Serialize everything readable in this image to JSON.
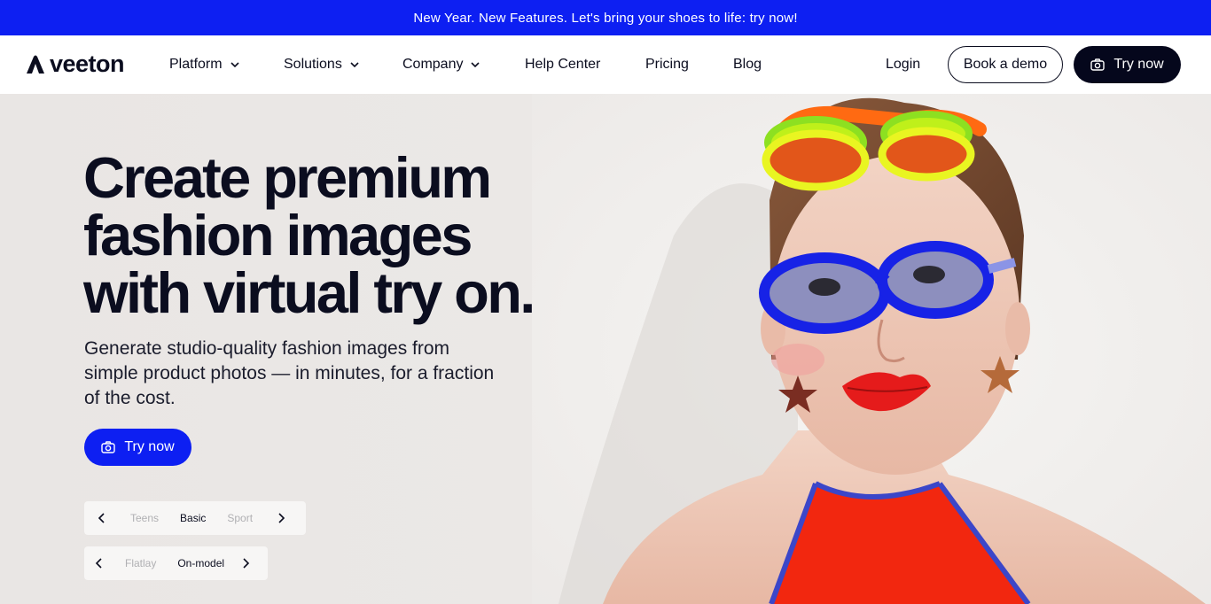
{
  "announcement": "New Year. New Features. Let's bring your shoes to life: try now!",
  "brand": {
    "name": "veeton"
  },
  "nav": {
    "items": [
      {
        "label": "Platform",
        "dropdown": true
      },
      {
        "label": "Solutions",
        "dropdown": true
      },
      {
        "label": "Company",
        "dropdown": true
      },
      {
        "label": "Help Center",
        "dropdown": false
      },
      {
        "label": "Pricing",
        "dropdown": false
      },
      {
        "label": "Blog",
        "dropdown": false
      }
    ],
    "login": "Login",
    "book_demo": "Book a demo",
    "try_now": "Try now"
  },
  "hero": {
    "headline": [
      "Create premium",
      "fashion images",
      "with virtual try on."
    ],
    "subtitle": [
      "Generate studio-quality fashion images from",
      "simple product photos — in minutes, for a fraction",
      "of the cost."
    ],
    "cta": "Try now"
  },
  "picker_style": {
    "options": [
      "Teens",
      "Basic",
      "Sport"
    ],
    "selected": "Basic"
  },
  "picker_mode": {
    "options": [
      "Flatlay",
      "On-model"
    ],
    "selected": "On-model"
  },
  "colors": {
    "accent": "#0d1ff2",
    "dark": "#05071c",
    "background": "#ebe8e6"
  },
  "icons": {
    "camera": "camera-icon",
    "chevron_down": "chevron-down-icon",
    "chevron_left": "chevron-left-icon",
    "chevron_right": "chevron-right-icon"
  }
}
